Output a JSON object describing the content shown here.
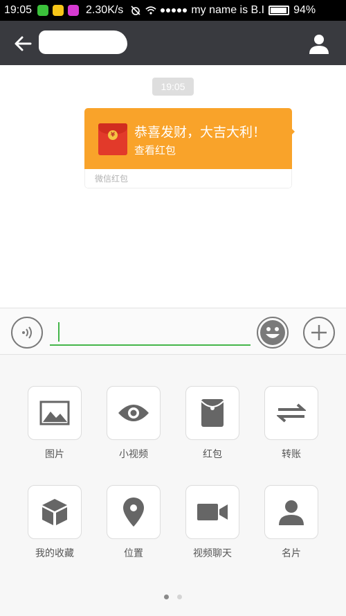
{
  "status_bar": {
    "time": "19:05",
    "speed": "2.30K/s",
    "carrier": "my name is B.I",
    "battery": "94%"
  },
  "header": {
    "back_icon": "arrow-left-icon",
    "profile_icon": "person-icon"
  },
  "chat": {
    "timestamp": "19:05",
    "red_packet": {
      "title": "恭喜发财，大吉大利！",
      "action": "查看红包",
      "label": "微信红包",
      "color": "#f9a32a"
    }
  },
  "input_bar": {
    "voice_icon": "voice-icon",
    "emoji_icon": "emoji-icon",
    "plus_icon": "plus-icon",
    "accent": "#44b549"
  },
  "panel": {
    "tools": [
      {
        "label": "图片",
        "icon": "image-icon"
      },
      {
        "label": "小视频",
        "icon": "eye-icon"
      },
      {
        "label": "红包",
        "icon": "red-packet-icon"
      },
      {
        "label": "转账",
        "icon": "transfer-icon"
      },
      {
        "label": "我的收藏",
        "icon": "cube-icon"
      },
      {
        "label": "位置",
        "icon": "location-pin-icon"
      },
      {
        "label": "视频聊天",
        "icon": "video-camera-icon"
      },
      {
        "label": "名片",
        "icon": "contact-card-icon"
      }
    ],
    "page_count": 2,
    "current_page": 1
  }
}
